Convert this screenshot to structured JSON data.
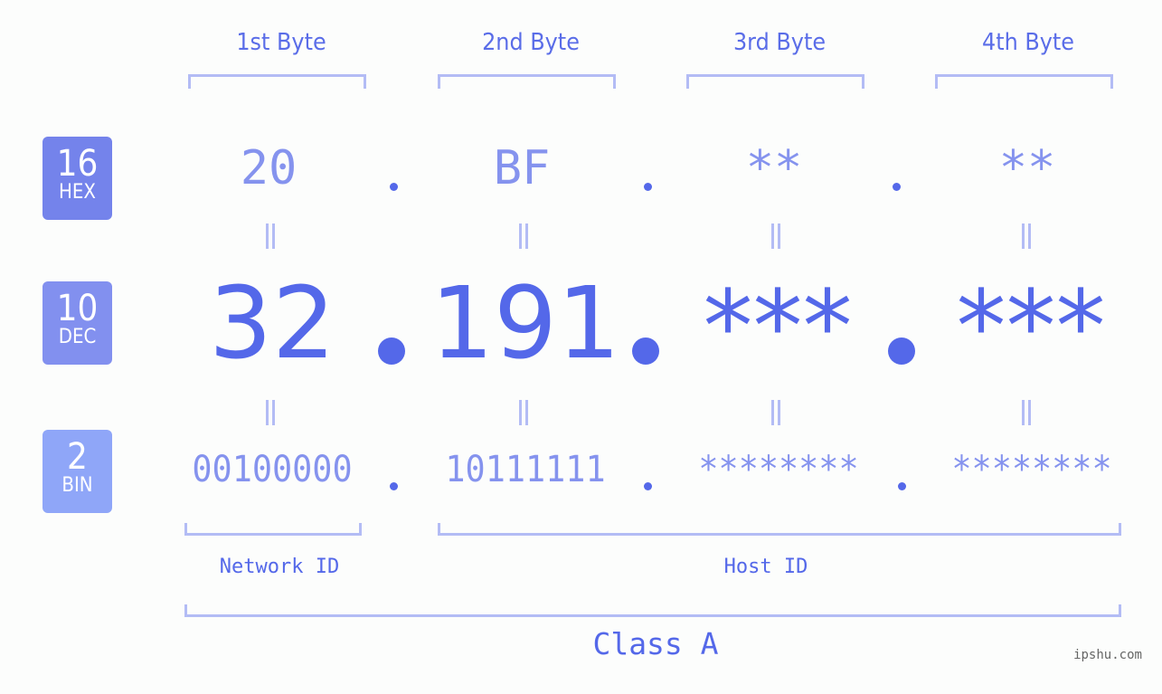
{
  "bytes": [
    {
      "label": "1st Byte",
      "hex": "20",
      "dec": "32",
      "bin": "00100000"
    },
    {
      "label": "2nd Byte",
      "hex": "BF",
      "dec": "191",
      "bin": "10111111"
    },
    {
      "label": "3rd Byte",
      "hex": "**",
      "dec": "***",
      "bin": "********"
    },
    {
      "label": "4th Byte",
      "hex": "**",
      "dec": "***",
      "bin": "********"
    }
  ],
  "bases": {
    "hex": {
      "num": "16",
      "label": "HEX",
      "color": "#7483eb"
    },
    "dec": {
      "num": "10",
      "label": "DEC",
      "color": "#8290ef"
    },
    "bin": {
      "num": "2",
      "label": "BIN",
      "color": "#8fa6f8"
    }
  },
  "parts": {
    "network": "Network ID",
    "host": "Host ID",
    "class": "Class A"
  },
  "watermark": "ipshu.com",
  "colors": {
    "accent": "#5468e9",
    "light": "#8593ee",
    "bracket": "#b3bcf5"
  }
}
